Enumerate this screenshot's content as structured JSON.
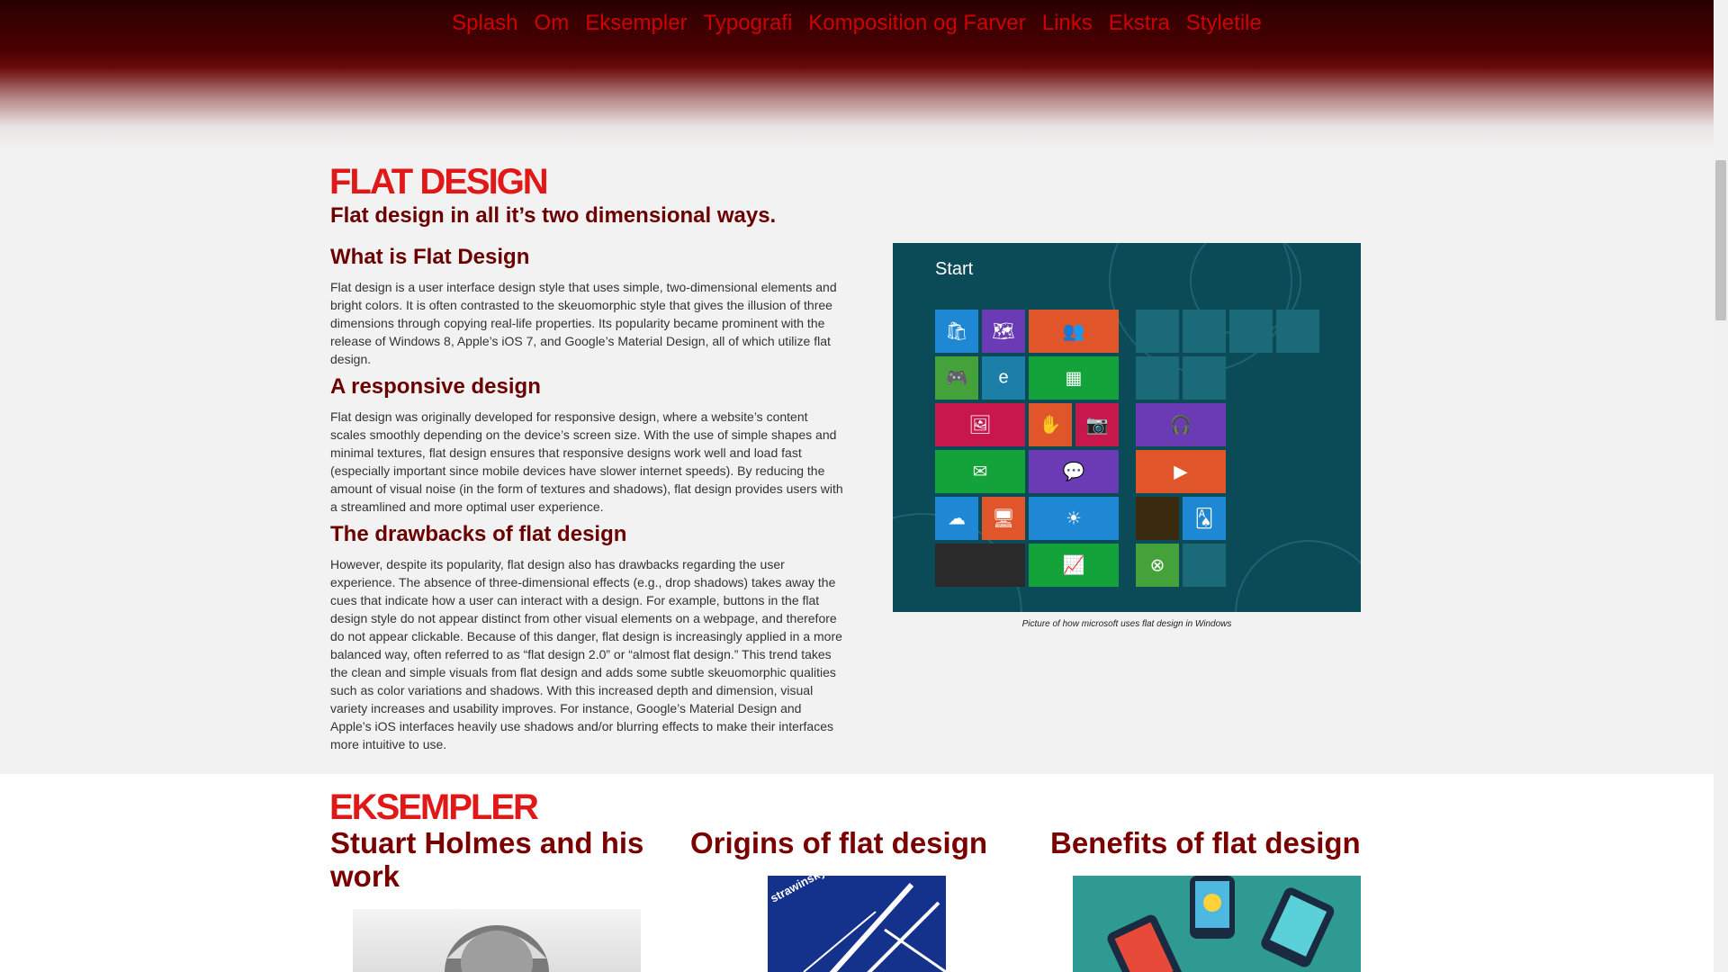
{
  "nav": [
    "Splash",
    "Om",
    "Eksempler",
    "Typografi",
    "Komposition og Farver",
    "Links",
    "Ekstra",
    "Styletile"
  ],
  "flat": {
    "heading": "FLAT DESIGN",
    "subtitle": "Flat design in all it’s two dimensional ways.",
    "what_heading": "What is Flat Design",
    "what_text": "Flat design is a user interface design style that uses simple, two-dimensional elements and bright colors. It is often contrasted to the skeuomorphic style that gives the illusion of three dimensions through copying real-life properties. Its popularity became prominent with the release of Windows 8, Apple’s iOS 7, and Google’s Material Design, all of which utilize flat design.",
    "responsive_heading": "A responsive design",
    "responsive_text": "Flat design was originally developed for responsive design, where a website’s content scales smoothly depending on the device’s screen size. With the use of simple shapes and minimal textures, flat design ensures that responsive designs work well and load fast (especially important since mobile devices have slower internet speeds). By reducing the amount of visual noise (in the form of textures and shadows), flat design provides users with a streamlined and more optimal user experience.",
    "drawbacks_heading": "The drawbacks of flat design",
    "drawbacks_text": "However, despite its popularity, flat design also has drawbacks regarding the user experience. The absence of three-dimensional effects (e.g., drop shadows) takes away the cues that indicate how a user can interact with a design. For example, buttons in the flat design style do not appear distinct from other visual elements on a webpage, and therefore do not appear clickable. Because of this danger, flat design is increasingly applied in a more balanced way, often referred to as “flat design 2.0” or “almost flat design.” This trend takes the clean and simple visuals from flat design and adds some subtle skeuomorphic qualities such as color variations and shadows. With this increased depth and dimension, visual variety increases and usability improves. For instance, Google’s Material Design and Apple’s iOS interfaces heavily use shadows and/or blurring effects to make their interfaces more intuitive to use.",
    "image": {
      "start_label": "Start",
      "caption": "Picture of how microsoft uses flat design in Windows"
    }
  },
  "eksempler": {
    "heading": "EKSEMPLER",
    "col1_title": "Stuart Holmes and his work",
    "col2_title": "Origins of flat design",
    "col3_title": "Benefits of flat design",
    "poster_text": "strawinsky"
  },
  "colors": {
    "nav_link": "#d10000",
    "section_heading": "#e01818",
    "subheading": "#6b0000",
    "windows_bg": "#0b4a57"
  }
}
